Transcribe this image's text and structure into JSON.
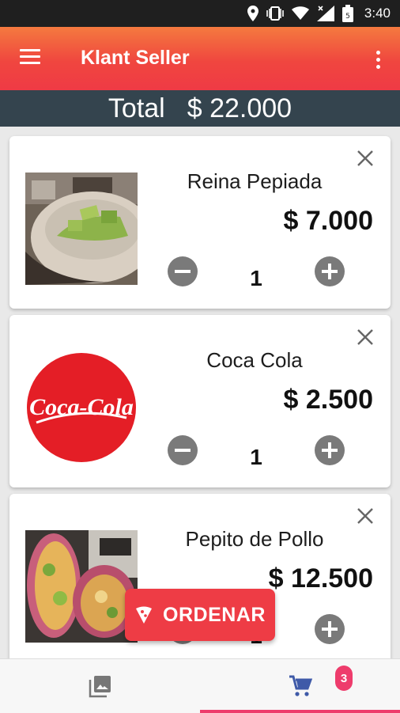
{
  "status_bar": {
    "time": "3:40"
  },
  "app_bar": {
    "title": "Klant Seller"
  },
  "total": {
    "label": "Total",
    "value": "$ 22.000"
  },
  "cart_items": [
    {
      "name": "Reina Pepiada",
      "price": "$ 7.000",
      "quantity": "1",
      "image": "arepa-photo"
    },
    {
      "name": "Coca Cola",
      "price": "$ 2.500",
      "quantity": "1",
      "image": "coca-cola-logo",
      "logo_text": "Coca-Cola"
    },
    {
      "name": "Pepito de Pollo",
      "price": "$ 12.500",
      "quantity": "1",
      "image": "wrap-photo"
    }
  ],
  "order_button": {
    "label": "ORDENAR"
  },
  "bottom_nav": {
    "cart_badge": "3",
    "active_tab": "cart"
  },
  "colors": {
    "app_bar": "#ef3a45",
    "total_bar": "#34444e",
    "accent": "#ee3c6c",
    "cart_active": "#3f5aa8"
  }
}
